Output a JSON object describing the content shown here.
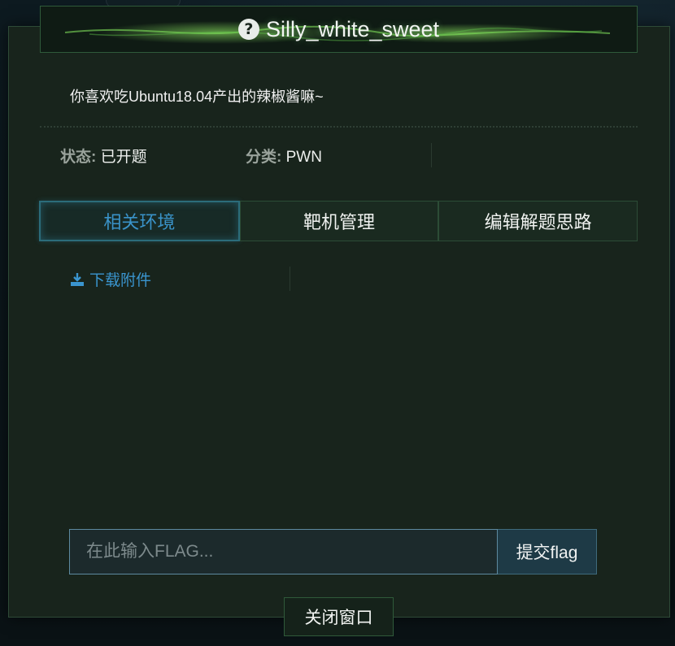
{
  "modal": {
    "title": "Silly_white_sweet",
    "description": "你喜欢吃Ubuntu18.04产出的辣椒酱嘛~",
    "status_label": "状态:",
    "status_value": "已开题",
    "category_label": "分类:",
    "category_value": "PWN",
    "tabs": [
      {
        "label": "相关环境",
        "active": true
      },
      {
        "label": "靶机管理",
        "active": false
      },
      {
        "label": "编辑解题思路",
        "active": false
      }
    ],
    "download_label": "下载附件",
    "flag_placeholder": "在此输入FLAG...",
    "submit_label": "提交flag",
    "close_label": "关闭窗口"
  },
  "colors": {
    "accent_blue": "#3a95cf",
    "modal_bg": "#18241c",
    "border_green": "#2f5a3a"
  }
}
